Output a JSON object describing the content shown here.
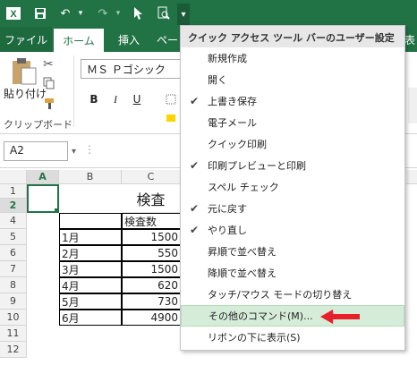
{
  "qat": {
    "save": "save-icon",
    "undo": "undo-icon",
    "redo": "redo-icon",
    "select": "select-icon",
    "preview": "print-preview-icon",
    "customize": "customize-qat-icon"
  },
  "tabs": {
    "file": "ファイル",
    "home": "ホーム",
    "insert": "挿入",
    "page": "ペー",
    "view": "表"
  },
  "ribbon": {
    "paste": "貼り付け",
    "clipboard": "クリップボード",
    "font": "ＭＳ Ｐゴシック",
    "bold": "B",
    "italic": "I"
  },
  "formula": {
    "namebox": "A2"
  },
  "columns": [
    "A",
    "B",
    "C"
  ],
  "rows": [
    "1",
    "2",
    "3",
    "4",
    "5",
    "6",
    "7",
    "8",
    "9",
    "10",
    "11",
    "12"
  ],
  "sheet": {
    "title": "検査",
    "header": "検査数",
    "data": [
      {
        "month": "1月",
        "value": "1500"
      },
      {
        "month": "2月",
        "value": "550"
      },
      {
        "month": "3月",
        "value": "1500"
      },
      {
        "month": "4月",
        "value": "620"
      },
      {
        "month": "5月",
        "value": "730"
      },
      {
        "month": "6月",
        "value": "4900"
      }
    ]
  },
  "menu": {
    "title": "クイック アクセス ツール バーのユーザー設定",
    "items": [
      {
        "label": "新規作成",
        "checked": false
      },
      {
        "label": "開く",
        "checked": false
      },
      {
        "label": "上書き保存",
        "checked": true
      },
      {
        "label": "電子メール",
        "checked": false
      },
      {
        "label": "クイック印刷",
        "checked": false
      },
      {
        "label": "印刷プレビューと印刷",
        "checked": true
      },
      {
        "label": "スペル チェック",
        "checked": false
      },
      {
        "label": "元に戻す",
        "checked": true
      },
      {
        "label": "やり直し",
        "checked": true
      },
      {
        "label": "昇順で並べ替え",
        "checked": false
      },
      {
        "label": "降順で並べ替え",
        "checked": false
      },
      {
        "label": "タッチ/マウス モードの切り替え",
        "checked": false
      },
      {
        "label": "その他のコマンド(M)...",
        "checked": false
      },
      {
        "label": "リボンの下に表示(S)",
        "checked": false
      }
    ],
    "check_glyph": "✔"
  },
  "colors": {
    "excel_green": "#217346",
    "highlight": "#d5ecd8",
    "arrow": "#e8202a"
  }
}
